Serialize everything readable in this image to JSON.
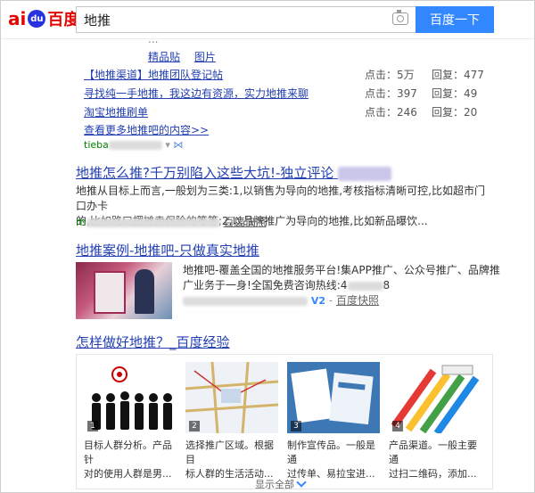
{
  "header": {
    "logo_bai": "ai",
    "logo_du": "du",
    "logo_cn": "百度",
    "query": "地推",
    "search_button": "百度一下"
  },
  "tieba": {
    "cut_text": "...",
    "subtabs": [
      "精品贴",
      "图片"
    ],
    "threads": [
      {
        "title": "【地推渠道】地推团队登记帖",
        "clicks": "点击：5万",
        "replies": "回复：477"
      },
      {
        "title": "寻找纯一手地推，我这边有资源，实力地推来聊",
        "clicks": "点击：397",
        "replies": "回复：49"
      },
      {
        "title": "淘宝地推刷单",
        "clicks": "点击：246",
        "replies": "回复：20"
      }
    ],
    "more": "查看更多地推吧的内容>>",
    "url": "tieba"
  },
  "result1": {
    "title": "地推怎么推?千万别陷入这些大坑!-独立评论",
    "line1": "地推从目标上而言,一般划为三类:1,以销售为导向的地推,考核指标清晰可控,比如超市门口办卡",
    "line2": "的,比如路口摆摊卖保险的等等;2,以品牌推广为导向的地推,比如新品曝饮...",
    "url": "m",
    "snapshot": "百度快照"
  },
  "result2": {
    "title": "地推案例-地推吧-只做真实地推",
    "line1": "地推吧-覆盖全国的地推服务平台!集APP推广、公众号推广、品牌推",
    "line2": "广业务于一身!全国免费咨询热线:4",
    "line2_tail": "8",
    "badge": "V2",
    "snapshot": "百度快照"
  },
  "result3": {
    "title": "怎样做好地推？_百度经验",
    "items": [
      {
        "num": "1",
        "caption1": "目标人群分析。产品针",
        "caption2": "对的使用人群是男..."
      },
      {
        "num": "2",
        "caption1": "选择推广区域。根据目",
        "caption2": "标人群的生活活动..."
      },
      {
        "num": "3",
        "caption1": "制作宣传品。一般是通",
        "caption2": "过传单、易拉宝进..."
      },
      {
        "num": "4",
        "caption1": "产品渠道。一般主要通",
        "caption2": "过扫二维码，添加..."
      }
    ],
    "show_all": "显示全部"
  }
}
